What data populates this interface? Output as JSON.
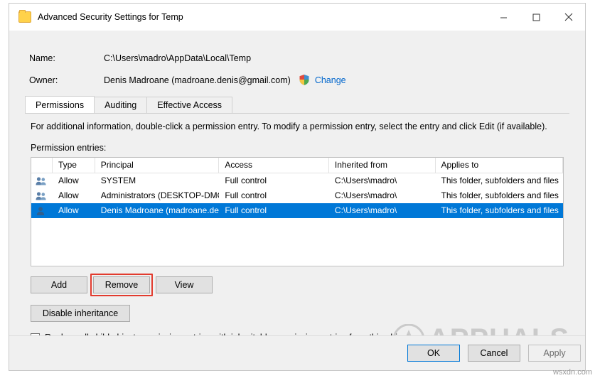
{
  "window": {
    "title": "Advanced Security Settings for Temp",
    "icon": "folder-icon",
    "minimize": "minimize-icon",
    "maximize": "maximize-icon",
    "close": "close-icon"
  },
  "fields": {
    "name_label": "Name:",
    "name_value": "C:\\Users\\madro\\AppData\\Local\\Temp",
    "owner_label": "Owner:",
    "owner_value": "Denis Madroane (madroane.denis@gmail.com)",
    "change_link": "Change"
  },
  "tabs": [
    {
      "label": "Permissions",
      "active": true
    },
    {
      "label": "Auditing",
      "active": false
    },
    {
      "label": "Effective Access",
      "active": false
    }
  ],
  "info_text": "For additional information, double-click a permission entry. To modify a permission entry, select the entry and click Edit (if available).",
  "entries_label": "Permission entries:",
  "table": {
    "headers": [
      "",
      "Type",
      "Principal",
      "Access",
      "Inherited from",
      "Applies to"
    ],
    "rows": [
      {
        "icon": "group-users-icon",
        "type": "Allow",
        "principal": "SYSTEM",
        "access": "Full control",
        "inherited": "C:\\Users\\madro\\",
        "applies": "This folder, subfolders and files",
        "selected": false
      },
      {
        "icon": "group-users-icon",
        "type": "Allow",
        "principal": "Administrators (DESKTOP-DMO...",
        "access": "Full control",
        "inherited": "C:\\Users\\madro\\",
        "applies": "This folder, subfolders and files",
        "selected": false
      },
      {
        "icon": "single-user-icon",
        "type": "Allow",
        "principal": "Denis Madroane (madroane.deni...",
        "access": "Full control",
        "inherited": "C:\\Users\\madro\\",
        "applies": "This folder, subfolders and files",
        "selected": true
      }
    ]
  },
  "buttons": {
    "add": "Add",
    "remove": "Remove",
    "view": "View",
    "disable_inheritance": "Disable inheritance",
    "ok": "OK",
    "cancel": "Cancel",
    "apply": "Apply"
  },
  "checkbox": {
    "label": "Replace all child object permission entries with inheritable permission entries from this object",
    "checked": false
  },
  "watermark": {
    "brand": "APPUALS",
    "corner": "wsxdn.com"
  },
  "colors": {
    "selection": "#0078d7",
    "link": "#0066cc",
    "highlight": "#e23b2e",
    "window_bg": "#f0f0f0"
  }
}
